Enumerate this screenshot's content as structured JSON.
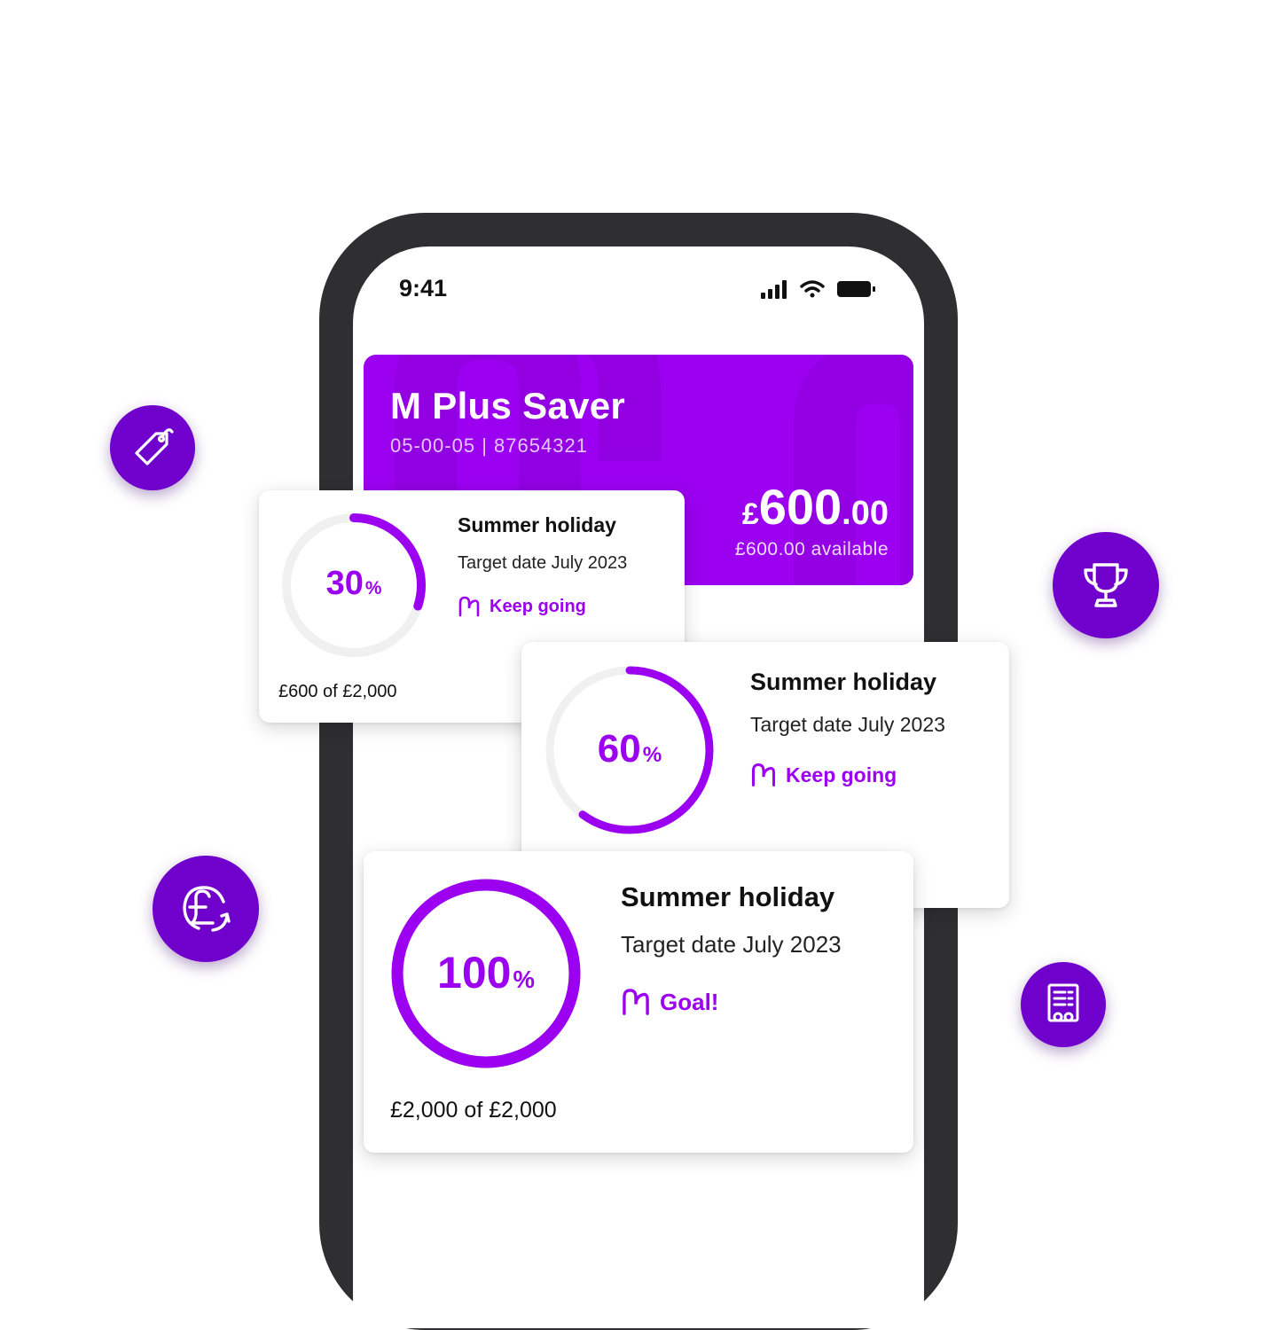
{
  "status_bar": {
    "time": "9:41"
  },
  "account": {
    "title": "M Plus Saver",
    "sort_code": "05-00-05",
    "account_number": "87654321",
    "balance_currency": "£",
    "balance_pounds": "600",
    "balance_pence": ".00",
    "available": "£600.00 available"
  },
  "goals": [
    {
      "percent": "30",
      "percent_sign": "%",
      "progress": 0.3,
      "title": "Summer holiday",
      "target_date": "Target date July 2023",
      "status": "Keep going",
      "amount": "£600 of £2,000"
    },
    {
      "percent": "60",
      "percent_sign": "%",
      "progress": 0.6,
      "title": "Summer holiday",
      "target_date": "Target date July 2023",
      "status": "Keep going",
      "amount": ""
    },
    {
      "percent": "100",
      "percent_sign": "%",
      "progress": 1.0,
      "title": "Summer holiday",
      "target_date": "Target date July 2023",
      "status": "Goal!",
      "amount": "£2,000 of £2,000"
    }
  ],
  "floating_icons": [
    "price-tag-icon",
    "trophy-icon",
    "pound-exchange-icon",
    "receipt-icon"
  ],
  "colors": {
    "brand_purple": "#9b00f0",
    "bubble_purple": "#7000cc",
    "ring_track": "#f0f0f0"
  }
}
